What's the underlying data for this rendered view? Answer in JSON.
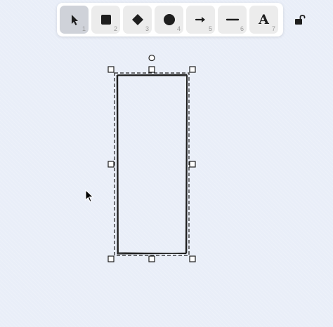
{
  "toolbar": {
    "tools": [
      {
        "name": "selection",
        "icon": "pointer-icon",
        "shortcut": "1",
        "selected": true
      },
      {
        "name": "rectangle",
        "icon": "square-icon",
        "shortcut": "2"
      },
      {
        "name": "diamond",
        "icon": "diamond-icon",
        "shortcut": "3"
      },
      {
        "name": "ellipse",
        "icon": "circle-icon",
        "shortcut": "4"
      },
      {
        "name": "arrow",
        "icon": "arrow-right-icon",
        "shortcut": "5"
      },
      {
        "name": "line",
        "icon": "line-icon",
        "shortcut": "6"
      },
      {
        "name": "text",
        "icon": "text-a-icon",
        "shortcut": "7",
        "glyph": "A"
      }
    ],
    "lock_icon": "unlock-icon"
  },
  "colors": {
    "canvas_bg": "#e9eef8",
    "toolbar_bg": "#ffffff",
    "tool_bg": "#ececec",
    "tool_selected_bg": "#cfd2d9",
    "stroke": "#1e1e1e"
  }
}
